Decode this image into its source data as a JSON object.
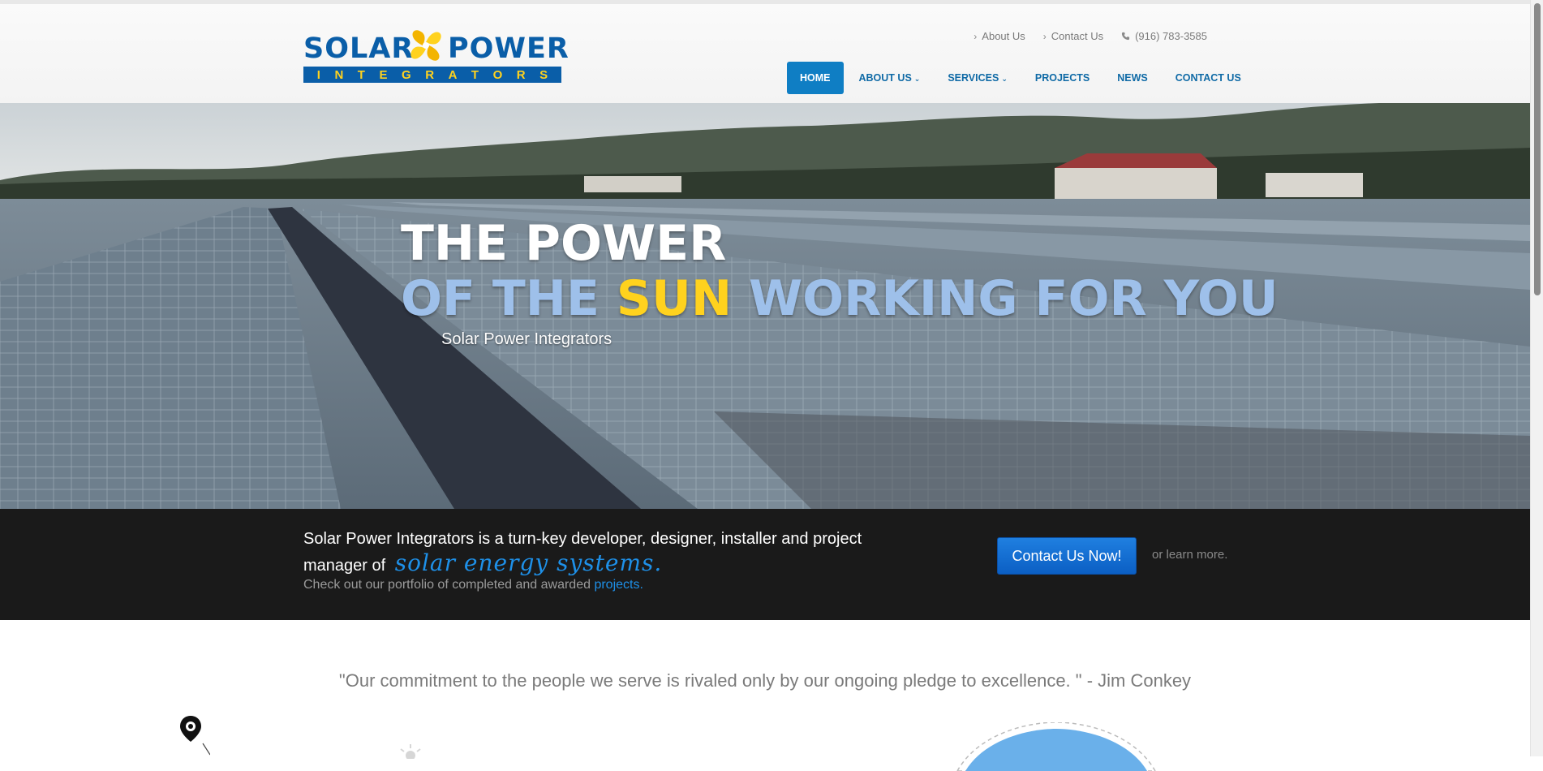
{
  "brand": {
    "logo_word_left": "SOLAR",
    "logo_word_right": "POWER",
    "logo_band_letters": [
      "I",
      "N",
      "T",
      "E",
      "G",
      "R",
      "A",
      "T",
      "O",
      "R",
      "S"
    ],
    "primary_color": "#0a5ea8",
    "accent_color": "#ffd21e"
  },
  "top_links": [
    {
      "label": "About Us",
      "icon": "chevron-right-icon"
    },
    {
      "label": "Contact Us",
      "icon": "chevron-right-icon"
    },
    {
      "label": "(916) 783-3585",
      "icon": "phone-icon"
    }
  ],
  "nav": {
    "items": [
      {
        "label": "HOME",
        "active": true
      },
      {
        "label": "ABOUT US",
        "dropdown": true
      },
      {
        "label": "SERVICES",
        "dropdown": true
      },
      {
        "label": "PROJECTS"
      },
      {
        "label": "NEWS"
      },
      {
        "label": "CONTACT US"
      }
    ],
    "active_color": "#0f7ec4"
  },
  "hero": {
    "line1": "THE POWER",
    "line2_prefix": "OF THE",
    "line2_highlight": "SUN",
    "line2_suffix": "WORKING FOR YOU",
    "subtitle": "Solar Power Integrators"
  },
  "band": {
    "text": "Solar Power Integrators is a turn-key developer, designer, installer and project manager of",
    "script_text": "solar energy systems.",
    "sub_text": "Check out our portfolio of completed and awarded",
    "sub_link": "projects.",
    "cta_label": "Contact Us Now!",
    "learn_more": "or learn more."
  },
  "quote": {
    "text": "\"Our commitment to the people we serve is rivaled only by our ongoing pledge to excellence. \" - Jim Conkey"
  }
}
